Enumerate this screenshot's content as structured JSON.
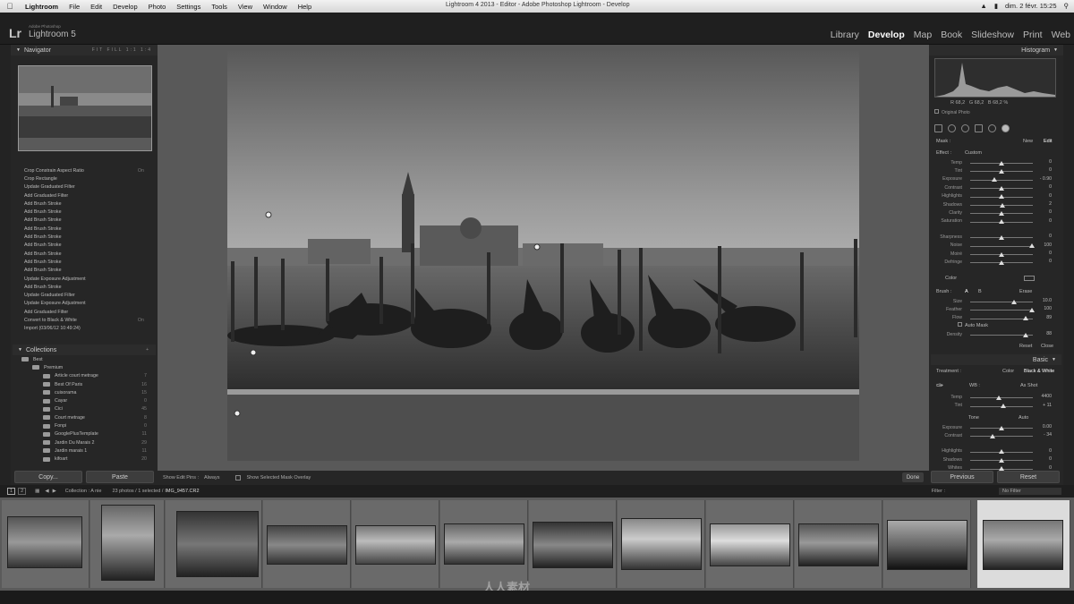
{
  "menubar": {
    "items": [
      "Lightroom",
      "File",
      "Edit",
      "Develop",
      "Photo",
      "Settings",
      "Tools",
      "View",
      "Window",
      "Help"
    ],
    "window_title": "Lightroom 4 2013 - Editor - Adobe Photoshop Lightroom - Develop",
    "clock": "dim. 2 févr. 15:25"
  },
  "identity": {
    "logo": "Lr",
    "brand_small": "Adobe Photoshop",
    "brand": "Lightroom 5"
  },
  "modules": [
    "Library",
    "Develop",
    "Map",
    "Book",
    "Slideshow",
    "Print",
    "Web"
  ],
  "navigator": {
    "title": "Navigator",
    "zoom_options": "FIT  FILL  1:1  1:4"
  },
  "history": [
    {
      "label": "Crop Constrain Aspect Ratio",
      "n": "On"
    },
    {
      "label": "Crop Rectangle",
      "n": ""
    },
    {
      "label": "Update Graduated Filter",
      "n": ""
    },
    {
      "label": "Add Graduated Filter",
      "n": ""
    },
    {
      "label": "Add Brush Stroke",
      "n": ""
    },
    {
      "label": "Add Brush Stroke",
      "n": ""
    },
    {
      "label": "Add Brush Stroke",
      "n": ""
    },
    {
      "label": "Add Brush Stroke",
      "n": ""
    },
    {
      "label": "Add Brush Stroke",
      "n": ""
    },
    {
      "label": "Add Brush Stroke",
      "n": ""
    },
    {
      "label": "Add Brush Stroke",
      "n": ""
    },
    {
      "label": "Add Brush Stroke",
      "n": ""
    },
    {
      "label": "Add Brush Stroke",
      "n": ""
    },
    {
      "label": "Update Exposure Adjustment",
      "n": ""
    },
    {
      "label": "Add Brush Stroke",
      "n": ""
    },
    {
      "label": "Update Graduated Filter",
      "n": ""
    },
    {
      "label": "Update Exposure Adjustment",
      "n": ""
    },
    {
      "label": "Add Graduated Filter",
      "n": ""
    },
    {
      "label": "Convert to Black & White",
      "n": "On"
    },
    {
      "label": "Import (03/06/12 10:49:24)",
      "n": ""
    }
  ],
  "collections": {
    "title": "Collections",
    "items": [
      {
        "label": "Best",
        "n": ""
      },
      {
        "label": "Premium",
        "n": ""
      },
      {
        "label": "Article court metrage",
        "n": "7"
      },
      {
        "label": "Best Of Paris",
        "n": "16"
      },
      {
        "label": "cuisorama",
        "n": "15"
      },
      {
        "label": "Cayar",
        "n": "0"
      },
      {
        "label": "Cici",
        "n": "45"
      },
      {
        "label": "Court metrage",
        "n": "8"
      },
      {
        "label": "Fonpi",
        "n": "0"
      },
      {
        "label": "GooglePlusTemplate",
        "n": "11"
      },
      {
        "label": "Jardin Du Marais 2",
        "n": "29"
      },
      {
        "label": "Jardin marais 1",
        "n": "11"
      },
      {
        "label": "kifoart",
        "n": "20"
      }
    ]
  },
  "left_buttons": {
    "copy": "Copy...",
    "paste": "Paste"
  },
  "toolbar": {
    "show_edit_pins": "Show Edit Pins :",
    "pins_value": "Always",
    "overlay": "Show Selected Mask Overlay",
    "done": "Done"
  },
  "histogram": {
    "title": "Histogram",
    "r": "R  68,2",
    "g": "G  68,2",
    "b": "B  68,2  %",
    "original_photo": "Original Photo"
  },
  "mask": {
    "label": "Mask :",
    "new": "New",
    "edit": "Edit",
    "effect": "Effect :",
    "effect_value": "Custom",
    "sliders": [
      {
        "label": "Temp",
        "value": "0",
        "pos": 0.5
      },
      {
        "label": "Tint",
        "value": "0",
        "pos": 0.5
      },
      {
        "label": "Exposure",
        "value": "- 0.90",
        "pos": 0.38
      },
      {
        "label": "Contrast",
        "value": "0",
        "pos": 0.5
      },
      {
        "label": "Highlights",
        "value": "0",
        "pos": 0.5
      },
      {
        "label": "Shadows",
        "value": "2",
        "pos": 0.51
      },
      {
        "label": "Clarity",
        "value": "0",
        "pos": 0.5
      },
      {
        "label": "Saturation",
        "value": "0",
        "pos": 0.5
      },
      {
        "label": "Sharpness",
        "value": "0",
        "pos": 0.5
      },
      {
        "label": "Noise",
        "value": "100",
        "pos": 0.98
      },
      {
        "label": "Moiré",
        "value": "0",
        "pos": 0.5
      },
      {
        "label": "Defringe",
        "value": "0",
        "pos": 0.5
      }
    ],
    "color": "Color"
  },
  "brush": {
    "label": "Brush :",
    "a": "A",
    "b": "B",
    "erase": "Erase",
    "sliders": [
      {
        "label": "Size",
        "value": "10.0",
        "pos": 0.7
      },
      {
        "label": "Feather",
        "value": "100",
        "pos": 0.98
      },
      {
        "label": "Flow",
        "value": "89",
        "pos": 0.88
      }
    ],
    "auto_mask": "Auto Mask",
    "density": {
      "label": "Density",
      "value": "88",
      "pos": 0.88
    },
    "reset": "Reset",
    "close": "Close"
  },
  "basic": {
    "title": "Basic",
    "treatment": "Treatment :",
    "color": "Color",
    "bw": "Black & White",
    "wb": "WB :",
    "wb_value": "As Shot",
    "temp": {
      "label": "Temp",
      "value": "4400",
      "pos": 0.45
    },
    "tint": {
      "label": "Tint",
      "value": "+ 11",
      "pos": 0.53
    },
    "tone": "Tone",
    "auto": "Auto",
    "tone_sliders": [
      {
        "label": "Exposure",
        "value": "0.00",
        "pos": 0.5
      },
      {
        "label": "Contrast",
        "value": "- 34",
        "pos": 0.36
      },
      {
        "label": "Highlights",
        "value": "0",
        "pos": 0.5
      },
      {
        "label": "Shadows",
        "value": "0",
        "pos": 0.5
      },
      {
        "label": "Whites",
        "value": "0",
        "pos": 0.5
      }
    ]
  },
  "right_buttons": {
    "previous": "Previous",
    "reset": "Reset"
  },
  "filmstrip_bar": {
    "page1": "1",
    "page2": "2",
    "source": "Collection : A nie",
    "count": "23 photos / 1 selected /",
    "file": "IMG_9457.CR2",
    "filter_label": "Filter :",
    "filter_value": "No Filter"
  },
  "watermark": "人人素材"
}
